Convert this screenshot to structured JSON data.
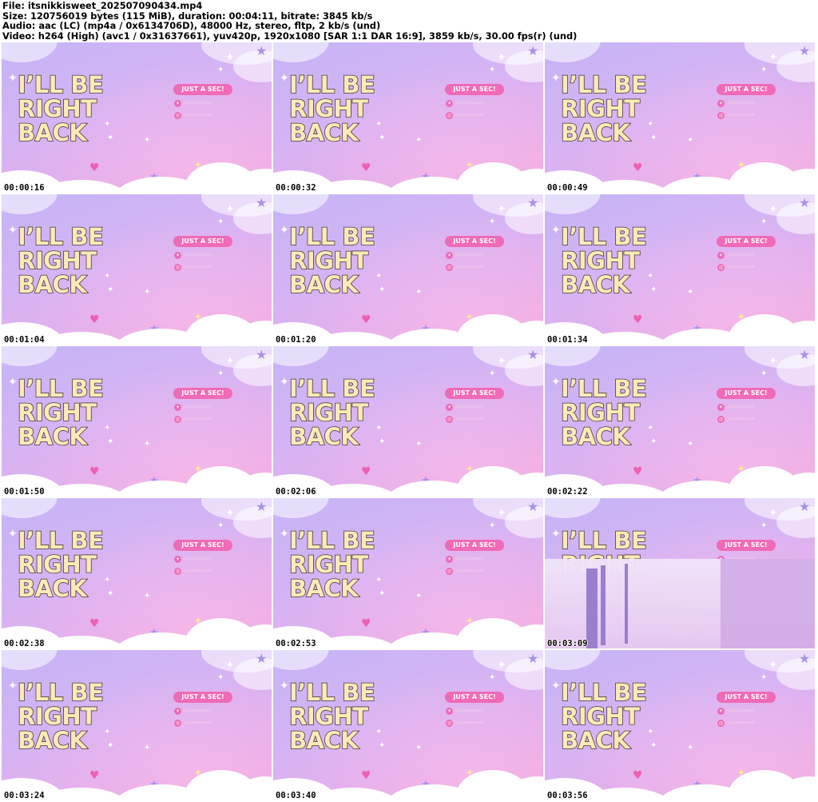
{
  "header": {
    "lines": [
      "File: itsnikkisweet_202507090434.mp4",
      "Size: 120756019 bytes (115 MiB), duration: 00:04:11, bitrate: 3845 kb/s",
      "Audio: aac (LC) (mp4a / 0x6134706D), 48000 Hz, stereo, fltp, 2 kb/s (und)",
      "Video: h264 (High) (avc1 / 0x31637661), yuv420p, 1920x1080 [SAR 1:1 DAR 16:9], 3859 kb/s, 30.00 fps(r) (und)"
    ]
  },
  "overlay": {
    "title_lines": [
      "I’LL BE",
      "RIGHT",
      "BACK"
    ],
    "pill": "JUST A SEC!",
    "twitter_handle": "@itsnikkisweet",
    "instagram_handle": "@itsnikkisweet"
  },
  "thumbnails": [
    {
      "timestamp": "00:00:16"
    },
    {
      "timestamp": "00:00:32"
    },
    {
      "timestamp": "00:00:49"
    },
    {
      "timestamp": "00:01:04"
    },
    {
      "timestamp": "00:01:20"
    },
    {
      "timestamp": "00:01:34"
    },
    {
      "timestamp": "00:01:50"
    },
    {
      "timestamp": "00:02:06"
    },
    {
      "timestamp": "00:02:22"
    },
    {
      "timestamp": "00:02:38"
    },
    {
      "timestamp": "00:02:53"
    },
    {
      "timestamp": "00:03:09",
      "transition": true
    },
    {
      "timestamp": "00:03:24"
    },
    {
      "timestamp": "00:03:40"
    },
    {
      "timestamp": "00:03:56"
    }
  ],
  "colors": {
    "title_fill": "#fbeab6",
    "title_stroke": "#4c3a3c",
    "pill": "#f06ab6",
    "heart": "#f05fb3",
    "star_purple": "#a592ee",
    "star_yellow": "#fde69c"
  },
  "icons": [
    "twitter-icon",
    "instagram-icon",
    "sparkle-icon",
    "heart-icon",
    "star-icon",
    "cloud-icon"
  ]
}
